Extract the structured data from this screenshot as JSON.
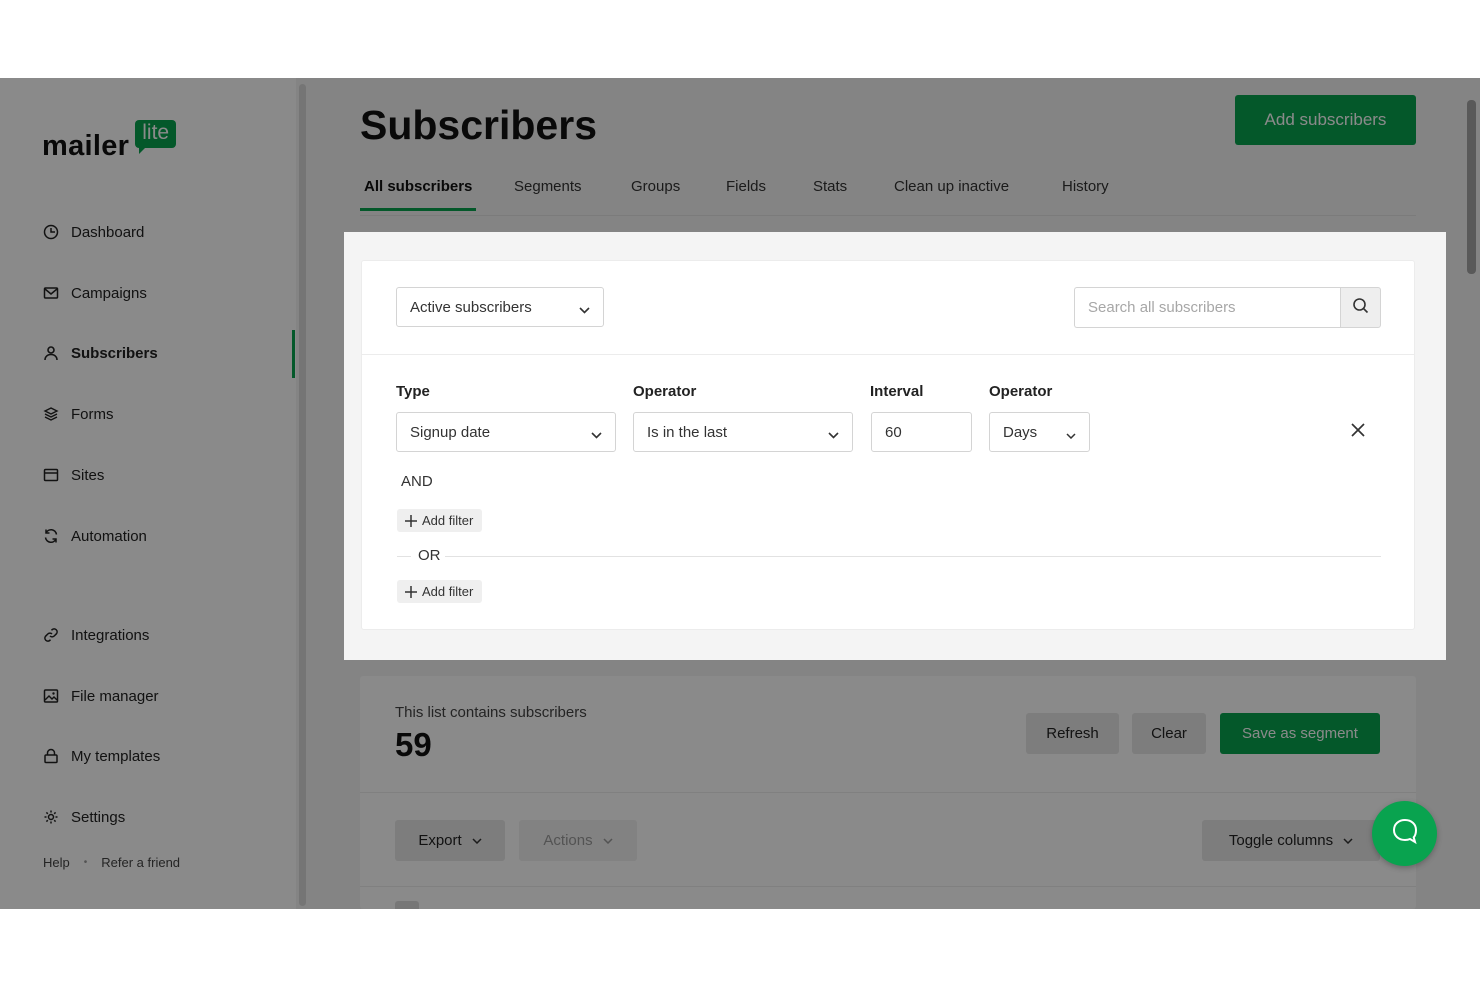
{
  "brand": {
    "word": "mailer",
    "badge": "lite",
    "accent": "#09a34f"
  },
  "sidebar": {
    "items": [
      {
        "label": "Dashboard",
        "icon": "clock-icon"
      },
      {
        "label": "Campaigns",
        "icon": "envelope-icon"
      },
      {
        "label": "Subscribers",
        "icon": "user-icon",
        "active": true
      },
      {
        "label": "Forms",
        "icon": "layers-icon"
      },
      {
        "label": "Sites",
        "icon": "browser-icon"
      },
      {
        "label": "Automation",
        "icon": "refresh-icon"
      },
      {
        "label": "Integrations",
        "icon": "link-icon"
      },
      {
        "label": "File manager",
        "icon": "image-icon"
      },
      {
        "label": "My templates",
        "icon": "lock-icon"
      },
      {
        "label": "Settings",
        "icon": "gear-icon"
      }
    ],
    "footer": {
      "help": "Help",
      "refer": "Refer a friend"
    }
  },
  "header": {
    "title": "Subscribers",
    "add_button": "Add subscribers",
    "tabs": [
      {
        "label": "All subscribers",
        "active": true
      },
      {
        "label": "Segments"
      },
      {
        "label": "Groups"
      },
      {
        "label": "Fields"
      },
      {
        "label": "Stats"
      },
      {
        "label": "Clean up inactive"
      },
      {
        "label": "History"
      }
    ]
  },
  "filter_panel": {
    "status_select": "Active subscribers",
    "search_placeholder": "Search all subscribers",
    "labels": {
      "type": "Type",
      "operator": "Operator",
      "interval": "Interval",
      "operator2": "Operator"
    },
    "values": {
      "type": "Signup date",
      "operator": "Is in the last",
      "interval": "60",
      "unit": "Days"
    },
    "and_label": "AND",
    "or_label": "OR",
    "add_filter": "Add filter"
  },
  "results": {
    "caption": "This list contains subscribers",
    "count": "59",
    "refresh": "Refresh",
    "clear": "Clear",
    "save_segment": "Save as segment",
    "export": "Export",
    "actions": "Actions",
    "toggle_columns": "Toggle columns"
  }
}
